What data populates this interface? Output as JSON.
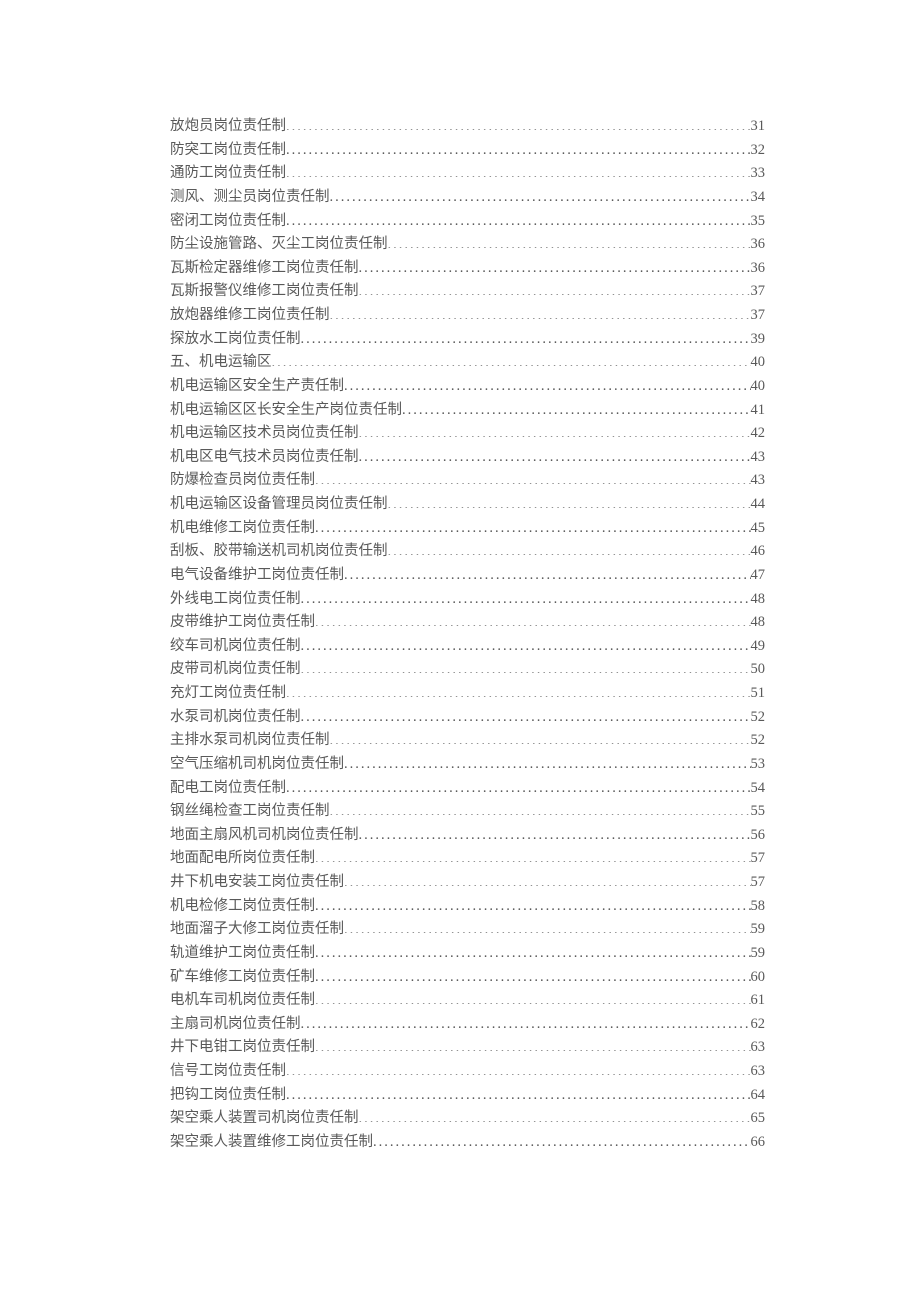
{
  "toc": [
    {
      "title": "放炮员岗位责任制",
      "page": "31"
    },
    {
      "title": "防突工岗位责任制",
      "page": "32"
    },
    {
      "title": "通防工岗位责任制",
      "page": "33"
    },
    {
      "title": "测风、测尘员岗位责任制",
      "page": "34"
    },
    {
      "title": "密闭工岗位责任制",
      "page": "35"
    },
    {
      "title": "防尘设施管路、灭尘工岗位责任制",
      "page": "36"
    },
    {
      "title": "瓦斯检定器维修工岗位责任制",
      "page": "36"
    },
    {
      "title": "瓦斯报警仪维修工岗位责任制",
      "page": "37"
    },
    {
      "title": "放炮器维修工岗位责任制",
      "page": "37"
    },
    {
      "title": "探放水工岗位责任制",
      "page": "39"
    },
    {
      "title": "五、机电运输区",
      "page": "40"
    },
    {
      "title": "机电运输区安全生产责任制",
      "page": "40"
    },
    {
      "title": "机电运输区区长安全生产岗位责任制",
      "page": "41"
    },
    {
      "title": "机电运输区技术员岗位责任制",
      "page": "42"
    },
    {
      "title": "机电区电气技术员岗位责任制",
      "page": "43"
    },
    {
      "title": "防爆检查员岗位责任制",
      "page": "43"
    },
    {
      "title": "机电运输区设备管理员岗位责任制",
      "page": "44"
    },
    {
      "title": "机电维修工岗位责任制",
      "page": "45"
    },
    {
      "title": "刮板、胶带输送机司机岗位责任制",
      "page": "46"
    },
    {
      "title": "电气设备维护工岗位责任制",
      "page": "47"
    },
    {
      "title": "外线电工岗位责任制",
      "page": "48"
    },
    {
      "title": "皮带维护工岗位责任制",
      "page": "48"
    },
    {
      "title": "绞车司机岗位责任制",
      "page": "49"
    },
    {
      "title": "皮带司机岗位责任制",
      "page": "50"
    },
    {
      "title": "充灯工岗位责任制",
      "page": "51"
    },
    {
      "title": "水泵司机岗位责任制",
      "page": "52"
    },
    {
      "title": "主排水泵司机岗位责任制",
      "page": "52"
    },
    {
      "title": "空气压缩机司机岗位责任制",
      "page": "53"
    },
    {
      "title": "配电工岗位责任制",
      "page": "54"
    },
    {
      "title": "钢丝绳检查工岗位责任制",
      "page": "55"
    },
    {
      "title": "地面主扇风机司机岗位责任制",
      "page": "56"
    },
    {
      "title": "地面配电所岗位责任制",
      "page": "57"
    },
    {
      "title": "井下机电安装工岗位责任制",
      "page": "57"
    },
    {
      "title": "机电检修工岗位责任制",
      "page": "58"
    },
    {
      "title": "地面溜子大修工岗位责任制",
      "page": "59"
    },
    {
      "title": "轨道维护工岗位责任制",
      "page": "59"
    },
    {
      "title": "矿车维修工岗位责任制",
      "page": "60"
    },
    {
      "title": "电机车司机岗位责任制",
      "page": "61"
    },
    {
      "title": "主扇司机岗位责任制",
      "page": "62"
    },
    {
      "title": "井下电钳工岗位责任制",
      "page": "63"
    },
    {
      "title": "信号工岗位责任制",
      "page": "63"
    },
    {
      "title": "把钩工岗位责任制",
      "page": "64"
    },
    {
      "title": "架空乘人装置司机岗位责任制",
      "page": "65"
    },
    {
      "title": "架空乘人装置维修工岗位责任制",
      "page": "66"
    }
  ]
}
